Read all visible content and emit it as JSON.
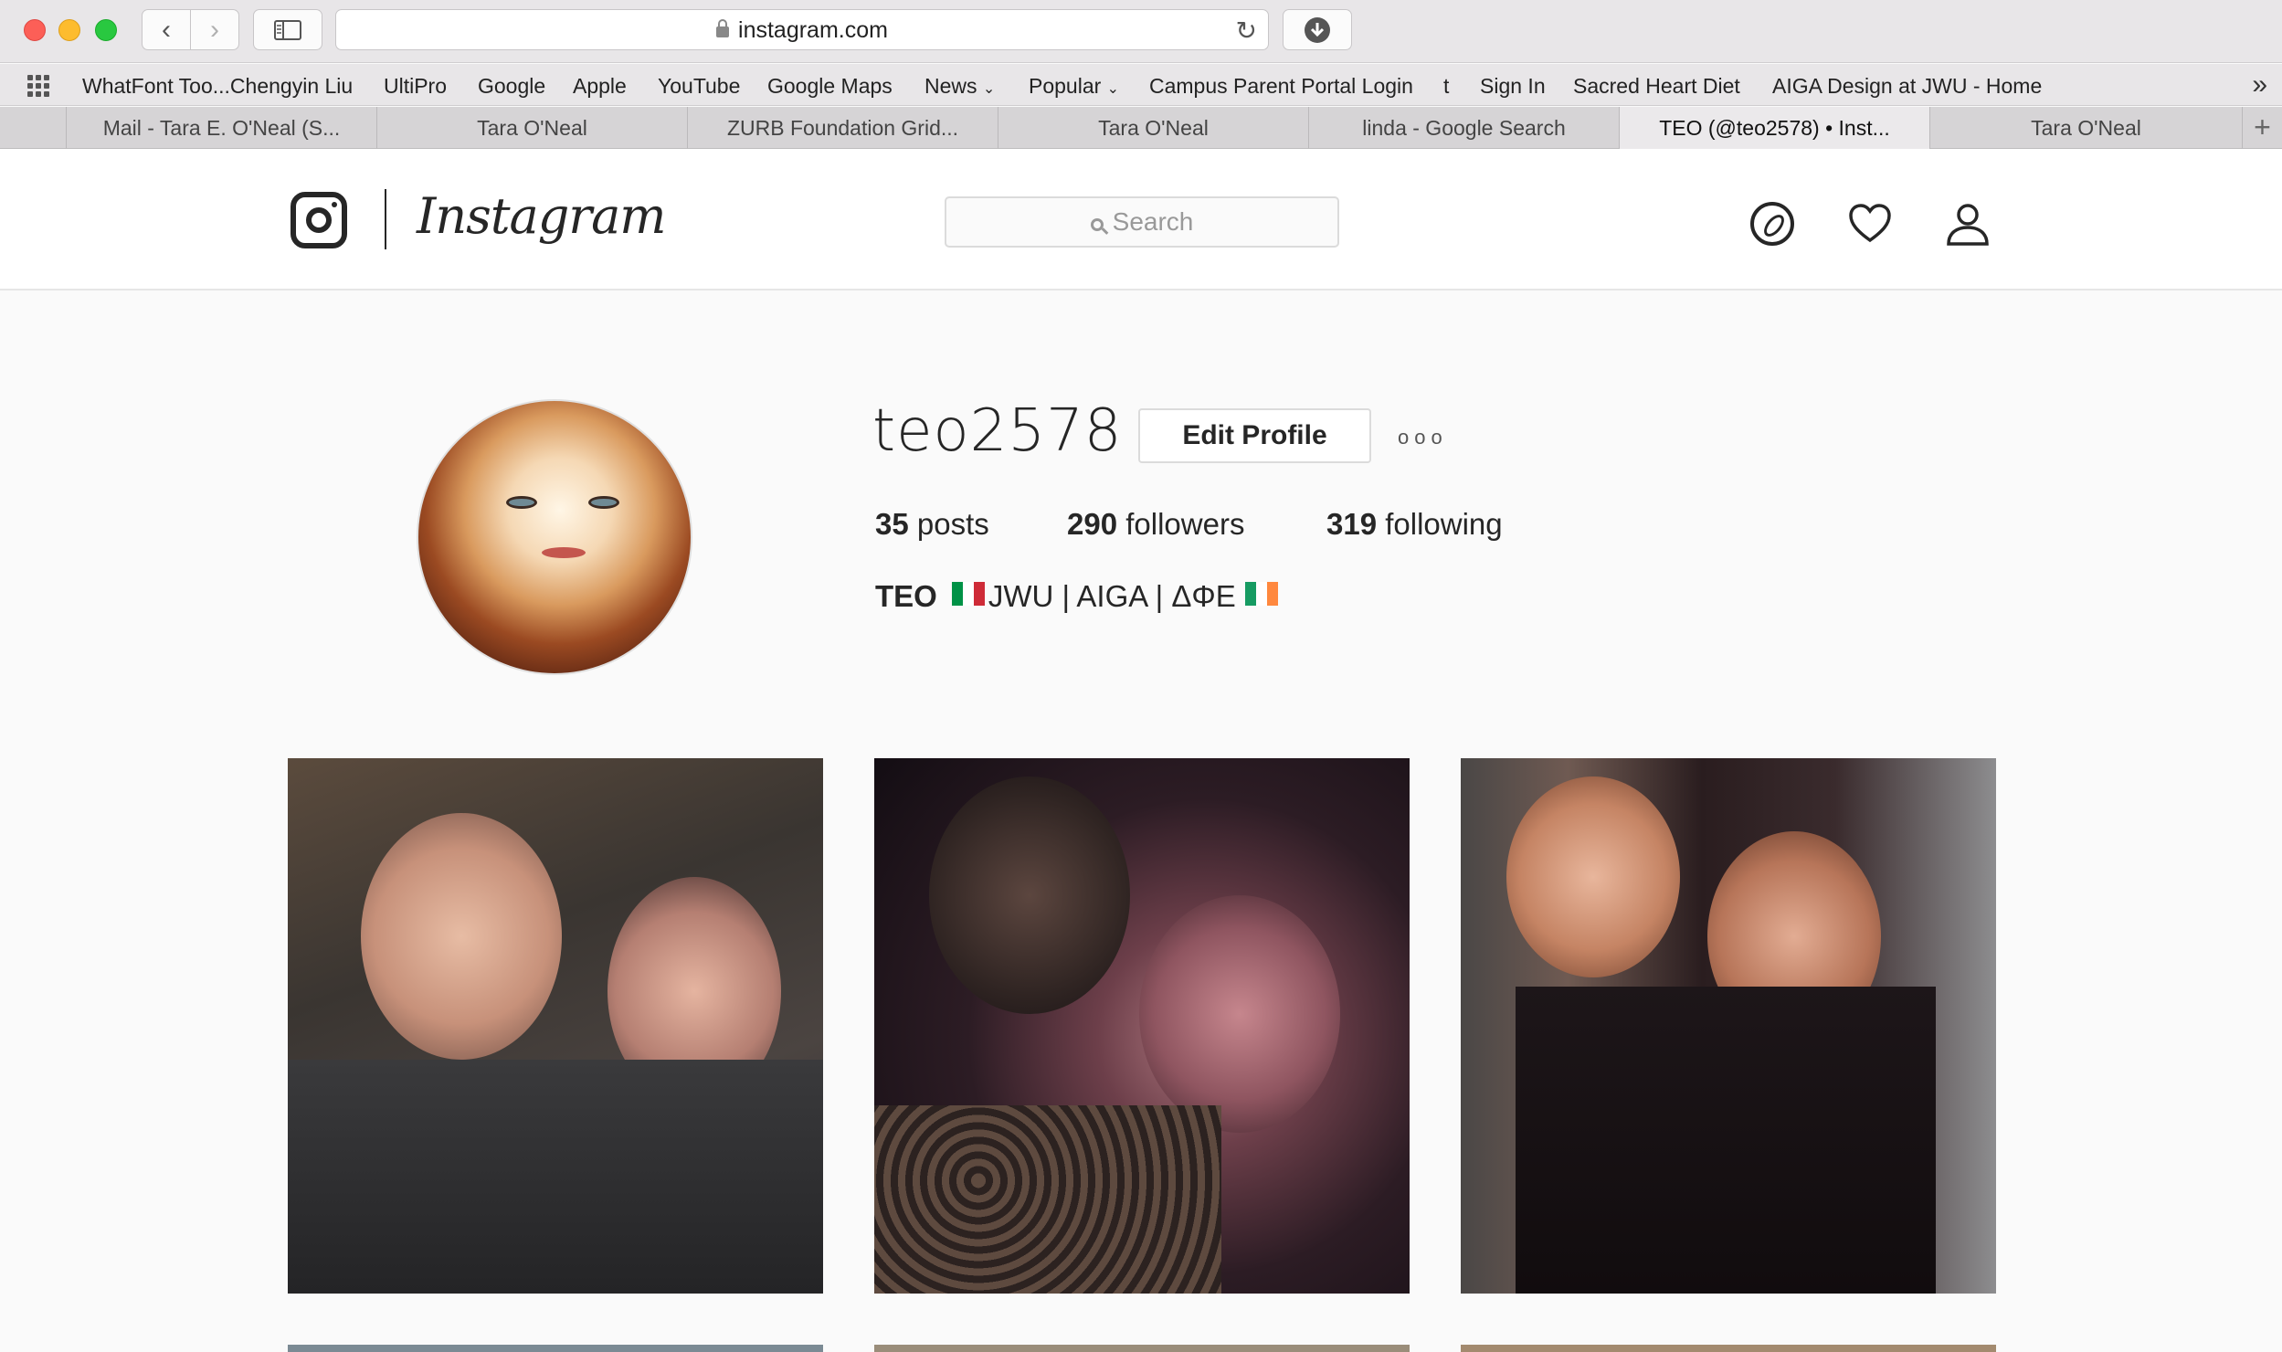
{
  "browser": {
    "url": "instagram.com",
    "bookmarks": [
      "WhatFont Too...Chengyin Liu",
      "UltiPro",
      "Google",
      "Apple",
      "YouTube",
      "Google Maps",
      "News",
      "Popular",
      "Campus Parent Portal Login",
      "t",
      "Sign In",
      "Sacred Heart Diet",
      "AIGA Design at JWU - Home"
    ],
    "tabs": [
      "Mail - Tara E. O'Neal (S...",
      "Tara O'Neal",
      "ZURB Foundation Grid...",
      "Tara O'Neal",
      "linda - Google Search",
      "TEO (@teo2578) • Inst...",
      "Tara O'Neal"
    ],
    "active_tab_index": 5
  },
  "header": {
    "wordmark": "Instagram",
    "search_placeholder": "Search"
  },
  "profile": {
    "username": "teo2578",
    "edit_button": "Edit Profile",
    "more": "ooo",
    "stats": {
      "posts_count": "35",
      "posts_label": "posts",
      "followers_count": "290",
      "followers_label": "followers",
      "following_count": "319",
      "following_label": "following"
    },
    "bio_name": "TEO",
    "bio_text": "JWU | AIGA | ΔΦΕ"
  },
  "icons": {
    "compass": "compass-icon",
    "heart": "heart-icon",
    "user": "user-icon"
  },
  "colors": {
    "text": "#262626",
    "border": "#dbdbdb",
    "background": "#fafafa"
  }
}
